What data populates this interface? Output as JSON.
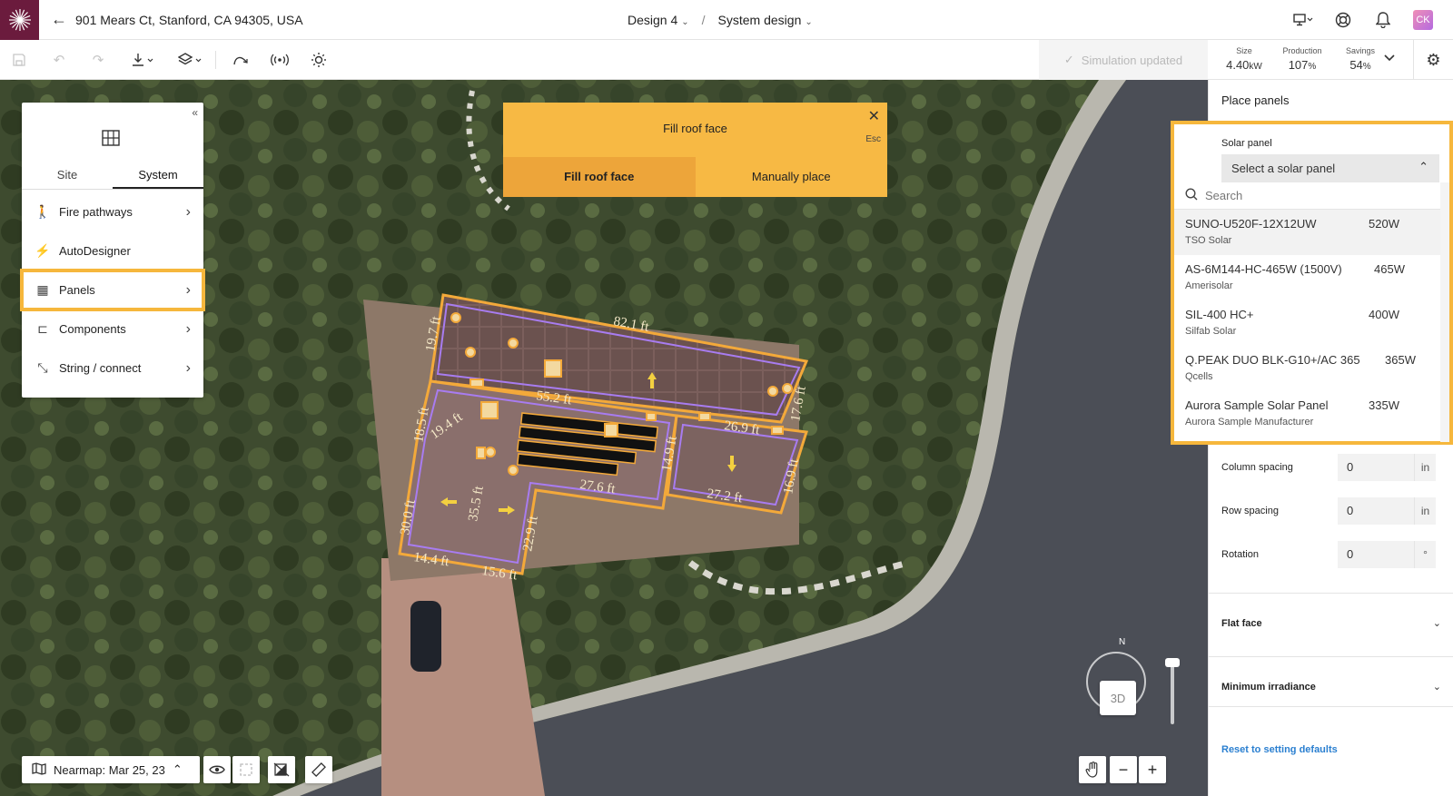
{
  "header": {
    "address": "901 Mears Ct, Stanford, CA 94305, USA",
    "design": "Design 4",
    "separator": "/",
    "section": "System design",
    "avatar_initials": "CK"
  },
  "toolbar": {
    "simulation_status": "Simulation updated",
    "stats": [
      {
        "label": "Size",
        "value": "4.40",
        "unit": "kW"
      },
      {
        "label": "Production",
        "value": "107",
        "unit": "%"
      },
      {
        "label": "Savings",
        "value": "54",
        "unit": "%"
      }
    ]
  },
  "left_panel": {
    "tabs": [
      "Site",
      "System"
    ],
    "active_tab": "System",
    "items": [
      {
        "label": "Fire pathways",
        "icon": "person-walking-icon",
        "has_arrow": true
      },
      {
        "label": "AutoDesigner",
        "icon": "magic-wand-icon",
        "has_arrow": false
      },
      {
        "label": "Panels",
        "icon": "grid-icon",
        "has_arrow": true
      },
      {
        "label": "Components",
        "icon": "component-icon",
        "has_arrow": true
      },
      {
        "label": "String / connect",
        "icon": "string-icon",
        "has_arrow": true
      }
    ],
    "selected_item": "Panels"
  },
  "fill_popup": {
    "title": "Fill roof face",
    "esc": "Esc",
    "tabs": [
      "Fill roof face",
      "Manually place"
    ],
    "active_tab": "Fill roof face"
  },
  "map": {
    "labels": [
      "82.1 ft",
      "19.7 ft",
      "55.2 ft",
      "26.9 ft",
      "17.6 ft",
      "18.5 ft",
      "19.4 ft",
      "27.6 ft",
      "14.9 ft",
      "27.2 ft",
      "16.9 ft",
      "35.5 ft",
      "22.9 ft",
      "30.0 ft",
      "14.4 ft",
      "15.6 ft"
    ],
    "imagery": "Nearmap: Mar 25, 23",
    "view_3d": "3D",
    "north": "N"
  },
  "right_panel": {
    "title": "Place panels",
    "solar_panel_label": "Solar panel",
    "select_placeholder": "Select a solar panel",
    "search_placeholder": "Search",
    "options": [
      {
        "name": "SUNO-U520F-12X12UW",
        "power": "520W",
        "manufacturer": "TSO Solar"
      },
      {
        "name": "AS-6M144-HC-465W (1500V)",
        "power": "465W",
        "manufacturer": "Amerisolar"
      },
      {
        "name": "SIL-400 HC+",
        "power": "400W",
        "manufacturer": "Silfab Solar"
      },
      {
        "name": "Q.PEAK DUO BLK-G10+/AC 365",
        "power": "365W",
        "manufacturer": "Qcells"
      },
      {
        "name": "Aurora Sample Solar Panel",
        "power": "335W",
        "manufacturer": "Aurora Sample Manufacturer"
      }
    ],
    "fields": [
      {
        "label": "Column spacing",
        "value": "0",
        "unit": "in"
      },
      {
        "label": "Row spacing",
        "value": "0",
        "unit": "in"
      },
      {
        "label": "Rotation",
        "value": "0",
        "unit": "°"
      }
    ],
    "sections": [
      "Flat face",
      "Minimum irradiance"
    ],
    "reset_label": "Reset to setting defaults"
  },
  "colors": {
    "accent": "#f6b73c",
    "brand": "#6b1b3d",
    "roof_outline": "#f3a93a",
    "link": "#2a7fd0"
  }
}
